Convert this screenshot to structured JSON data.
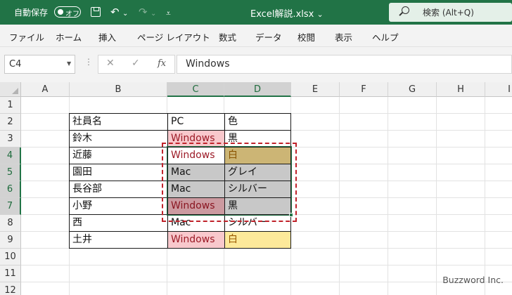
{
  "titlebar": {
    "autosave_label": "自動保存",
    "toggle_label": "オフ",
    "filename": "Excel解説.xlsx",
    "filename_caret": "⌄",
    "search_placeholder": "検索 (Alt+Q)",
    "save_icon": "save-icon",
    "undo_icon": "↶",
    "redo_icon": "↷",
    "dropdown_icon": "⌄",
    "customize_icon": "⩡"
  },
  "menu": {
    "items": [
      "ファイル",
      "ホーム",
      "挿入",
      "ページ レイアウト",
      "数式",
      "データ",
      "校閲",
      "表示",
      "ヘルプ"
    ]
  },
  "formula_bar": {
    "name_box": "C4",
    "name_box_caret": "▼",
    "dots": "⋮",
    "cancel_icon": "✕",
    "enter_icon": "✓",
    "fx_label": "fx",
    "formula_value": "Windows"
  },
  "sheet": {
    "columns": [
      "A",
      "B",
      "C",
      "D",
      "E",
      "F",
      "G",
      "H",
      "I"
    ],
    "rows": [
      "1",
      "2",
      "3",
      "4",
      "5",
      "6",
      "7",
      "8",
      "9",
      "10",
      "11",
      "12"
    ],
    "selected_columns": [
      "C",
      "D"
    ],
    "selected_rows": [
      "4",
      "5",
      "6",
      "7"
    ],
    "table": [
      {
        "name": "社員名",
        "os": "PC",
        "color": "色"
      },
      {
        "name": "鈴木",
        "os": "Windows",
        "color": "黒"
      },
      {
        "name": "近藤",
        "os": "Windows",
        "color": "白"
      },
      {
        "name": "園田",
        "os": "Mac",
        "color": "グレイ"
      },
      {
        "name": "長谷部",
        "os": "Mac",
        "color": "シルバー"
      },
      {
        "name": "小野",
        "os": "Windows",
        "color": "黒"
      },
      {
        "name": "西",
        "os": "Mac",
        "color": "シルバー"
      },
      {
        "name": "土井",
        "os": "Windows",
        "color": "白"
      }
    ],
    "colors": {
      "pink_fill": "#f8c8cc",
      "pink_text": "#9c1a26",
      "yellow_fill": "#fde99a",
      "yellow_text": "#9a5a00",
      "selection": "#217346",
      "annotation": "#c0222a"
    }
  },
  "credit": "Buzzword Inc."
}
